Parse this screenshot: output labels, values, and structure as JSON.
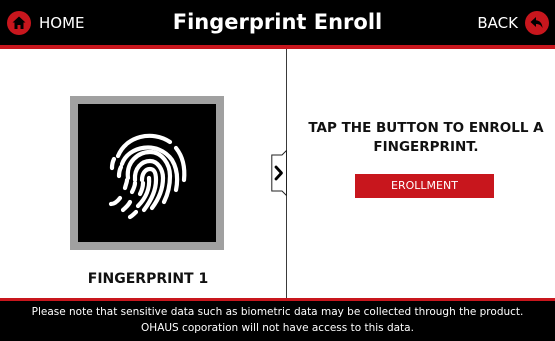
{
  "header": {
    "home_label": "HOME",
    "title": "Fingerprint Enroll",
    "back_label": "BACK",
    "home_icon": "home-icon",
    "back_icon": "back-arrow-icon"
  },
  "left_panel": {
    "fingerprint_icon": "fingerprint-icon",
    "caption": "FINGERPRINT 1"
  },
  "right_panel": {
    "instruction_line1": "TAP THE BUTTON TO ENROLL A",
    "instruction_line2": "FINGERPRINT.",
    "enroll_button_label": "EROLLMENT"
  },
  "footer": {
    "line1": "Please note that sensitive data such as biometric data may be collected through the product.",
    "line2": "OHAUS coporation will not have access to this data."
  },
  "colors": {
    "accent_red": "#c8161d",
    "header_bg": "#000000",
    "frame_gray": "#a0a0a0"
  }
}
